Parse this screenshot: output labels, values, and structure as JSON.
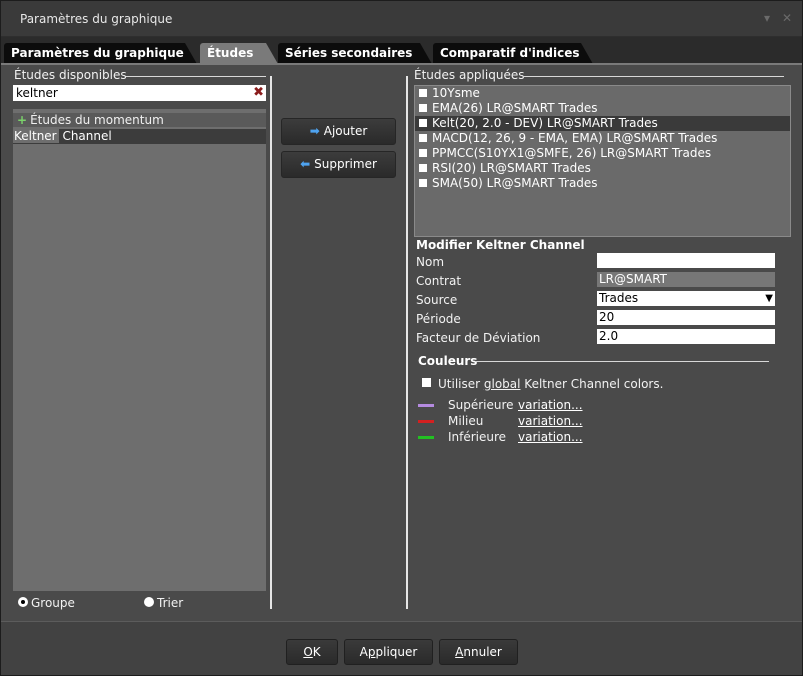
{
  "window": {
    "title": "Paramètres du graphique",
    "minimize_glyph": "▾",
    "close_glyph": "✕"
  },
  "tabs": [
    {
      "label": "Paramètres du graphique",
      "active": false
    },
    {
      "label": "Études",
      "active": true
    },
    {
      "label": "Séries secondaires",
      "active": false
    },
    {
      "label": "Comparatif d'indices",
      "active": false
    }
  ],
  "available": {
    "title": "Études disponibles",
    "search_value": "keltner",
    "clear_icon": "✖",
    "group_label": "Études du momentum",
    "item_match": "Keltner",
    "item_rest": " Channel",
    "radio_group": "Groupe",
    "radio_sort": "Trier"
  },
  "actions": {
    "add": "Ajouter",
    "remove": "Supprimer"
  },
  "applied": {
    "title": "Études appliquées",
    "items": [
      "10Ysme",
      "EMA(26) LR@SMART Trades",
      "Kelt(20, 2.0 - DEV) LR@SMART Trades",
      "MACD(12, 26, 9 - EMA, EMA) LR@SMART Trades",
      "PPMCC(S10YX1@SMFE, 26) LR@SMART Trades",
      "RSI(20) LR@SMART Trades",
      "SMA(50) LR@SMART Trades"
    ],
    "selected_index": 2
  },
  "modify": {
    "title": "Modifier Keltner Channel",
    "fields": [
      {
        "label": "Nom",
        "value": ""
      },
      {
        "label": "Contrat",
        "value": "LR@SMART"
      },
      {
        "label": "Source",
        "value": "Trades"
      },
      {
        "label": "Période",
        "value": "20"
      },
      {
        "label": "Facteur de Déviation",
        "value": "2.0"
      }
    ]
  },
  "colors": {
    "title": "Couleurs",
    "use_global_pre": "Utiliser ",
    "use_global_link": "global",
    "use_global_post": " Keltner Channel colors.",
    "lines": [
      {
        "label": "Supérieure",
        "link": "variation...",
        "color": "#b58be0"
      },
      {
        "label": "Milieu",
        "link": "variation...",
        "color": "#d42020"
      },
      {
        "label": "Inférieure",
        "link": "variation...",
        "color": "#22c022"
      }
    ]
  },
  "footer": {
    "ok_ul": "O",
    "ok_rest": "K",
    "apply_pre": "A",
    "apply_ul": "p",
    "apply_rest": "pliquer",
    "cancel_ul": "A",
    "cancel_rest": "nnuler"
  }
}
